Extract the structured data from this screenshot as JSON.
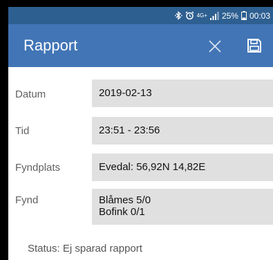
{
  "status_bar": {
    "network": "4G+",
    "battery_percent": "25%",
    "time": "00:03",
    "icons": [
      "bluetooth-icon",
      "alarm-icon",
      "signal-icon",
      "battery-icon"
    ]
  },
  "app_bar": {
    "title": "Rapport",
    "close_icon": "close-icon",
    "save_icon": "save-icon"
  },
  "form": {
    "datum": {
      "label": "Datum",
      "value": "2019-02-13"
    },
    "tid": {
      "label": "Tid",
      "value": "23:51 - 23:56"
    },
    "fyndplats": {
      "label": "Fyndplats",
      "value": "Evedal: 56,92N 14,82E"
    },
    "fynd": {
      "label": "Fynd",
      "lines": [
        "Blåmes 5/0",
        "Bofink 0/1"
      ]
    }
  },
  "status": "Status: Ej sparad rapport",
  "colors": {
    "status_bar": "#2e5f91",
    "app_bar": "#4275b6",
    "field_bg": "#e0e0e0",
    "label_text": "#616161"
  }
}
